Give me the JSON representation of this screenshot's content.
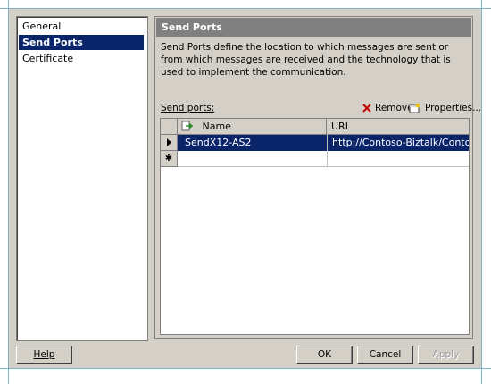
{
  "nav": {
    "items": [
      {
        "label": "General",
        "selected": false
      },
      {
        "label": "Send Ports",
        "selected": true
      },
      {
        "label": "Certificate",
        "selected": false
      }
    ]
  },
  "panel": {
    "title": "Send Ports",
    "description": "Send Ports define the location to which messages are sent or from which messages are received and the technology that is used to implement the communication.",
    "grid_label": "Send ports:",
    "remove_label": "Remove",
    "properties_label": "Properties...",
    "columns": [
      "Name",
      "URI"
    ],
    "rows": [
      {
        "name": "SendX12-AS2",
        "uri": "http://Contoso-Biztalk/Contoso/BTS..."
      }
    ],
    "new_row_glyph": "✱"
  },
  "buttons": {
    "help": "Help",
    "ok": "OK",
    "cancel": "Cancel",
    "apply": "Apply"
  },
  "colors": {
    "selection": "#0a246a",
    "dialog_bg": "#d4d0c8",
    "header_bg": "#808080",
    "remove_icon": "#c00000"
  }
}
